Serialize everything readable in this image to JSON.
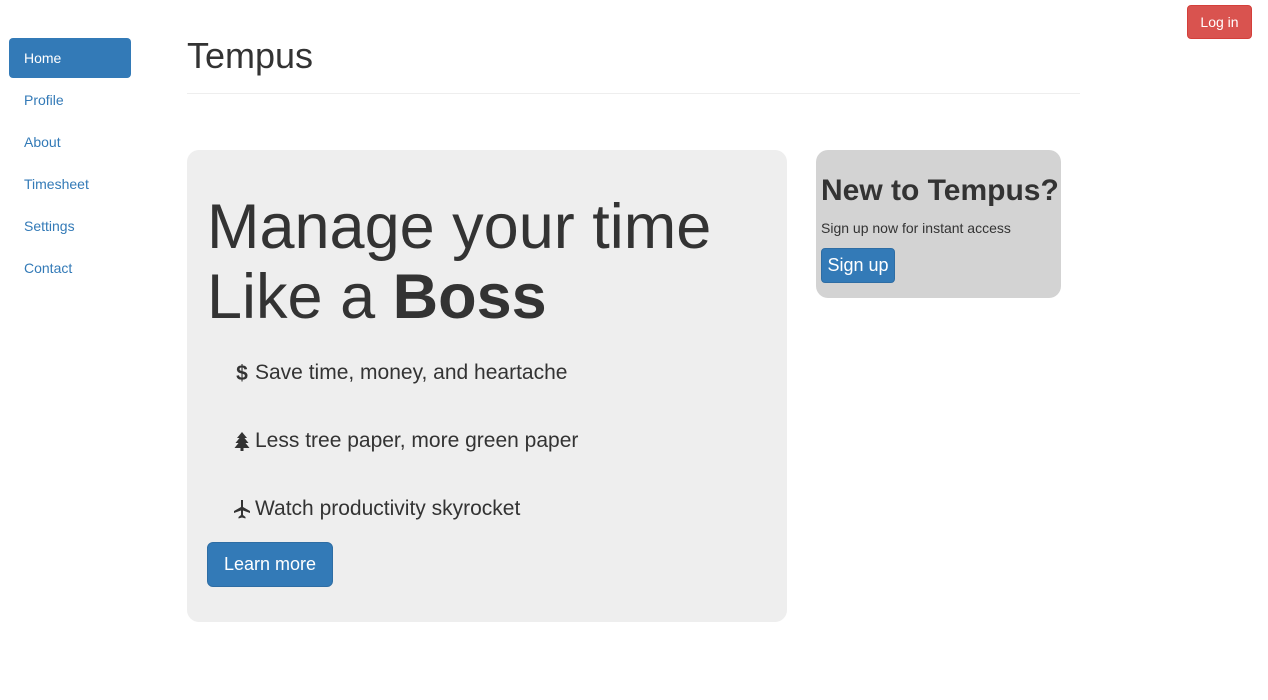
{
  "header": {
    "login_label": "Log in",
    "title": "Tempus"
  },
  "sidebar": {
    "items": [
      {
        "label": "Home",
        "active": true
      },
      {
        "label": "Profile",
        "active": false
      },
      {
        "label": "About",
        "active": false
      },
      {
        "label": "Timesheet",
        "active": false
      },
      {
        "label": "Settings",
        "active": false
      },
      {
        "label": "Contact",
        "active": false
      }
    ]
  },
  "hero": {
    "line1": "Manage your time",
    "line2_prefix": "Like a ",
    "line2_bold": "Boss",
    "features": [
      {
        "icon": "dollar-icon",
        "text": "Save time, money, and heartache"
      },
      {
        "icon": "tree-icon",
        "text": "Less tree paper, more green paper"
      },
      {
        "icon": "plane-icon",
        "text": "Watch productivity skyrocket"
      }
    ],
    "learn_more_label": "Learn more"
  },
  "signup": {
    "title": "New to Tempus?",
    "text": "Sign up now for instant access",
    "button_label": "Sign up"
  },
  "colors": {
    "primary": "#337ab7",
    "danger": "#d9534f",
    "jumbotron_bg": "#eeeeee",
    "signup_bg": "#d3d3d3",
    "text": "#333333"
  }
}
